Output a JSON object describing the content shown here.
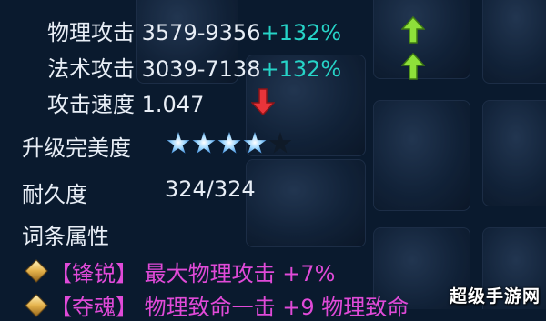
{
  "stats": [
    {
      "label": "物理攻击",
      "value": "3579-9356",
      "bonus": "+132%",
      "trend": "up"
    },
    {
      "label": "法术攻击",
      "value": "3039-7138",
      "bonus": "+132%",
      "trend": "up"
    },
    {
      "label": "攻击速度",
      "value": "1.047",
      "bonus": "",
      "trend": "down"
    }
  ],
  "upgrade": {
    "label": "升级完美度",
    "stars_filled": 4,
    "stars_total": 5
  },
  "durability": {
    "label": "耐久度",
    "value": "324/324"
  },
  "affix_section": {
    "title": "词条属性"
  },
  "affixes": [
    {
      "text": "【锋锐】 最大物理攻击 +7%"
    },
    {
      "text": "【夺魂】 物理致命一击 +9   物理致命"
    }
  ],
  "watermark": "超级手游网",
  "colors": {
    "bonus": "#26d3c7",
    "affix": "#e04ad8",
    "arrow_up": "#8ee03a",
    "arrow_down": "#e8343a"
  },
  "icons": {
    "up": "arrow-up-icon",
    "down": "arrow-down-icon",
    "star": "star-icon",
    "bullet": "diamond-bullet-icon"
  }
}
